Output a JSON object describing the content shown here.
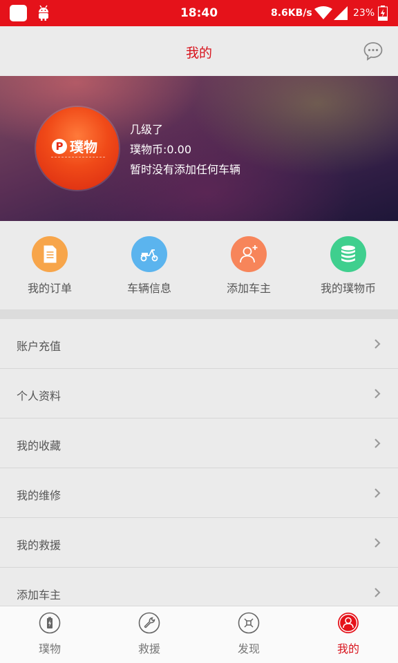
{
  "status_bar": {
    "time": "18:40",
    "network_speed": "8.6KB/s",
    "battery": "23%"
  },
  "header": {
    "title": "我的",
    "message_icon": "chat-bubble-icon"
  },
  "profile": {
    "logo_text": "璞物",
    "logo_letter": "P",
    "level": "几级了",
    "coins": "璞物币:0.00",
    "vehicle_note": "暂时没有添加任何车辆"
  },
  "quick_actions": [
    {
      "label": "我的订单",
      "icon": "document-icon",
      "color": "#f7a54a"
    },
    {
      "label": "车辆信息",
      "icon": "scooter-icon",
      "color": "#5bb4ee"
    },
    {
      "label": "添加车主",
      "icon": "add-user-icon",
      "color": "#f7855a"
    },
    {
      "label": "我的璞物币",
      "icon": "coin-stack-icon",
      "color": "#3fcf8e"
    }
  ],
  "menu": [
    {
      "label": "账户充值"
    },
    {
      "label": "个人资料"
    },
    {
      "label": "我的收藏"
    },
    {
      "label": "我的维修"
    },
    {
      "label": "我的救援"
    },
    {
      "label": "添加车主"
    }
  ],
  "bottom_nav": [
    {
      "label": "璞物",
      "icon": "battery-bolt-icon",
      "active": false
    },
    {
      "label": "救援",
      "icon": "wrench-icon",
      "active": false
    },
    {
      "label": "发现",
      "icon": "discover-icon",
      "active": false
    },
    {
      "label": "我的",
      "icon": "user-icon",
      "active": true
    }
  ],
  "colors": {
    "accent": "#d8131c",
    "status_bar": "#e5121a"
  }
}
